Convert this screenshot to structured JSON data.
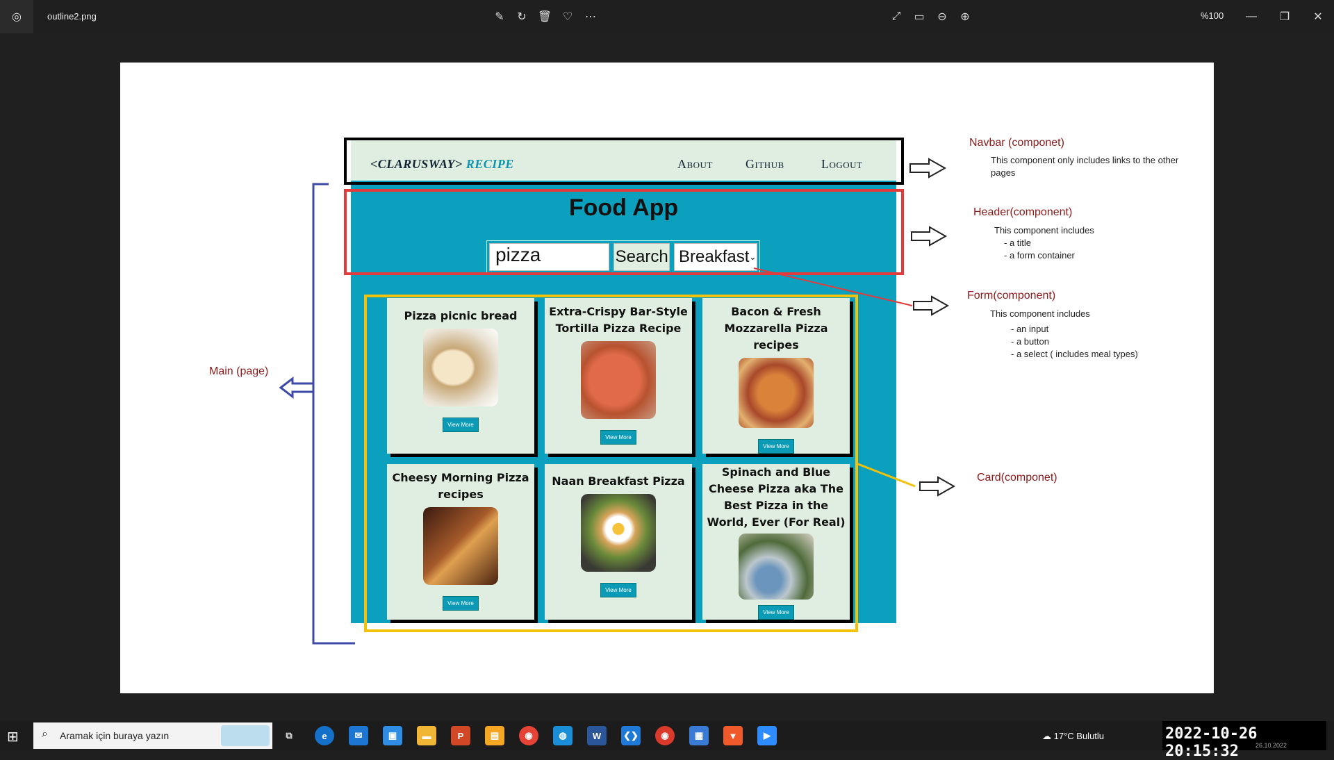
{
  "window": {
    "file_name": "outline2.png",
    "zoom_level": "%100"
  },
  "mockup": {
    "navbar": {
      "brand_main": "<CLARUSWAY>",
      "brand_accent": "RECIPE",
      "links": [
        "About",
        "Github",
        "Logout"
      ]
    },
    "header": {
      "title": "Food App",
      "search_value": "pizza",
      "search_button": "Search",
      "meal_select": "Breakfast"
    },
    "cards": [
      {
        "title": "Pizza picnic bread",
        "button": "View More"
      },
      {
        "title": "Extra-Crispy Bar-Style Tortilla Pizza Recipe",
        "button": "View More"
      },
      {
        "title": "Bacon & Fresh Mozzarella Pizza recipes",
        "button": "View More"
      },
      {
        "title": "Cheesy Morning Pizza recipes",
        "button": "View More"
      },
      {
        "title": "Naan Breakfast Pizza",
        "button": "View More"
      },
      {
        "title": "Spinach and Blue Cheese Pizza aka The Best Pizza in the World, Ever (For Real)",
        "button": "View More"
      }
    ]
  },
  "annotations": {
    "navbar": {
      "title": "Navbar (componet)",
      "text": "This component only includes links to the other pages"
    },
    "header": {
      "title": "Header(component)",
      "line1": "This component includes",
      "line2": "- a title",
      "line3": "- a form  container"
    },
    "form": {
      "title": "Form(component)",
      "line1": "This component includes",
      "line2": "- an input",
      "line3": "- a button",
      "line4": "- a select ( includes meal types)"
    },
    "main": {
      "title": "Main (page)"
    },
    "card": {
      "title": "Card(componet)"
    }
  },
  "taskbar": {
    "search_placeholder": "Aramak için buraya yazın",
    "weather": "17°C  Bulutlu",
    "time": "2022-10-26  20:15:32",
    "date": "26.10.2022"
  }
}
